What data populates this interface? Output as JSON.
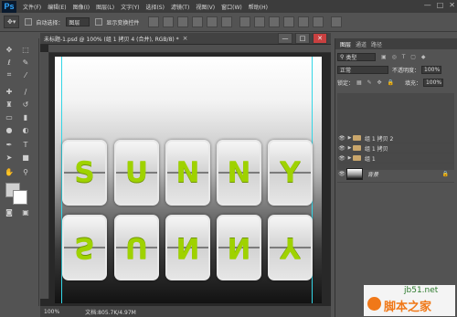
{
  "app": {
    "logo": "Ps"
  },
  "menubar": {
    "items": [
      "文件(F)",
      "编辑(E)",
      "图像(I)",
      "图层(L)",
      "文字(Y)",
      "选择(S)",
      "滤镜(T)",
      "视图(V)",
      "窗口(W)",
      "帮助(H)"
    ],
    "window_controls": [
      "—",
      "□",
      "✕"
    ]
  },
  "options_bar": {
    "tool_icon": "move-tool-icon",
    "auto_select_label": "自动选择：",
    "auto_select_value": "图层",
    "show_transform_label": "显示变换控件"
  },
  "document": {
    "title": "未标题-1.psd @ 100% (组 1 拷贝 4 (合并), RGB/8) *",
    "close": "×",
    "window_controls": [
      "—",
      "□",
      "✕"
    ]
  },
  "canvas": {
    "letters": [
      "S",
      "U",
      "N",
      "N",
      "Y"
    ],
    "letter_color": "#9fd200",
    "guide_color": "#33d6e6"
  },
  "status": {
    "zoom": "100%",
    "doc_info": "文档:805.7K/4.97M"
  },
  "panels": {
    "tabs": [
      "图层",
      "通道",
      "路径"
    ],
    "filter_kind": "类型",
    "blend_mode": "正常",
    "opacity_label": "不透明度：",
    "opacity_value": "100%",
    "lock_label": "锁定：",
    "fill_label": "填充：",
    "fill_value": "100%",
    "layers": [
      {
        "name": "组 1 拷贝 2",
        "visible": true
      },
      {
        "name": "组 1 拷贝",
        "visible": true
      },
      {
        "name": "组 1",
        "visible": true
      },
      {
        "name": "背景",
        "visible": true
      }
    ]
  },
  "watermark": {
    "line1": "jb51.net",
    "line2": "脚本之家"
  }
}
